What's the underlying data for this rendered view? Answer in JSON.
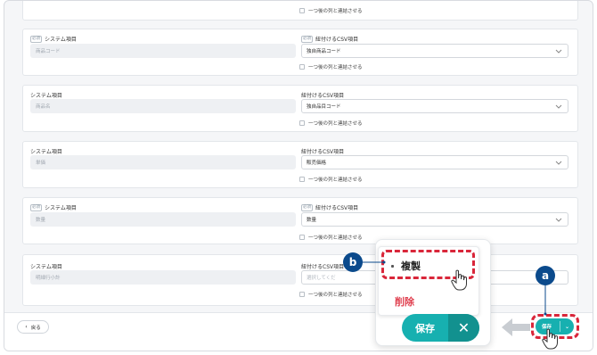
{
  "mapping_rows": [
    {
      "system_label": "",
      "system_value": "",
      "csv_label": "",
      "csv_value": "",
      "link_label": "一つ後の列と連結させる"
    },
    {
      "system_tag": "必須",
      "system_label": "システム項目",
      "system_value": "商品コード",
      "csv_tag": "必須",
      "csv_label": "紐付けるCSV項目",
      "csv_value": "独自商品コード",
      "link_label": "一つ後の列と連結させる"
    },
    {
      "system_label": "システム項目",
      "system_value": "商品名",
      "csv_label": "紐付けるCSV項目",
      "csv_value": "独自品目コード",
      "link_label": "一つ後の列と連結させる"
    },
    {
      "system_label": "システム項目",
      "system_value": "単価",
      "csv_label": "紐付けるCSV項目",
      "csv_value": "販売価格",
      "link_label": "一つ後の列と連結させる"
    },
    {
      "system_tag": "必須",
      "system_label": "システム項目",
      "system_value": "数量",
      "csv_tag": "必須",
      "csv_label": "紐付けるCSV項目",
      "csv_value": "数量",
      "link_label": "一つ後の列と連結させる"
    },
    {
      "system_label": "システム項目",
      "system_value": "明細行小計",
      "csv_label": "紐付けるCSV項目",
      "csv_value": "選択してくだ",
      "link_label": "一つ後の列と連結させる"
    }
  ],
  "footer": {
    "back_label": "戻る",
    "save_label": "保存"
  },
  "save_menu": {
    "copy_label": "複製",
    "delete_label": "削除",
    "save_label": "保存"
  },
  "callouts": {
    "a": "a",
    "b": "b"
  },
  "colors": {
    "teal": "#17b0b0",
    "teal_dark": "#12918f",
    "highlight_red": "#d9263a",
    "marker_navy": "#0b4a8c",
    "delete_red": "#e0404f"
  }
}
